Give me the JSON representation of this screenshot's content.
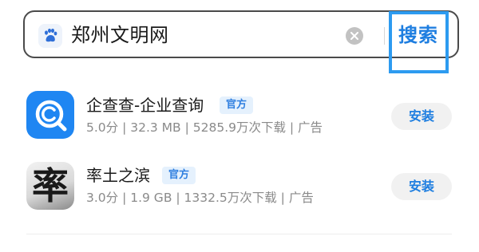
{
  "search": {
    "query": "郑州文明网",
    "button_label": "搜索"
  },
  "icons": {
    "search_engine": "baidu-paw-icon",
    "clear": "clear-icon",
    "app1": "qichacha-app-icon",
    "app2": "game-app-icon"
  },
  "colors": {
    "accent": "#1e7ee0",
    "highlight": "#2d9bf0",
    "badge_bg": "#e5f1fd",
    "qcc_icon": "#1f86f2"
  },
  "apps": [
    {
      "name": "企查查-企业查询",
      "badge": "官方",
      "meta": "5.0分 | 32.3 MB | 5285.9万次下载 | 广告",
      "install_label": "安装",
      "icon_char": ""
    },
    {
      "name": "率土之滨",
      "badge": "官方",
      "meta": "3.0分 | 1.9 GB | 1332.5万次下载 | 广告",
      "install_label": "安装",
      "icon_char": "率"
    }
  ]
}
